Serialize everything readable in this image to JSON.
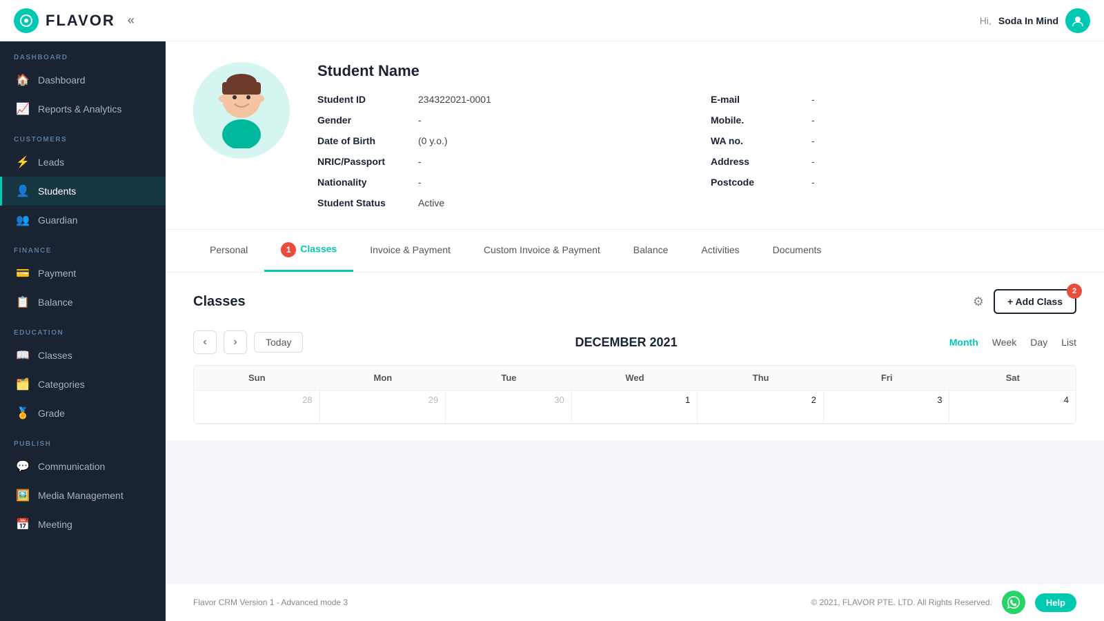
{
  "topnav": {
    "logo_text": "FLAVOR",
    "collapse_icon": "«",
    "greeting": "Hi,",
    "user_name": "Soda In Mind"
  },
  "sidebar": {
    "sections": [
      {
        "label": "DASHBOARD",
        "items": [
          {
            "id": "dashboard",
            "icon": "🏠",
            "label": "Dashboard",
            "active": false
          },
          {
            "id": "reports",
            "icon": "📈",
            "label": "Reports & Analytics",
            "active": false
          }
        ]
      },
      {
        "label": "CUSTOMERS",
        "items": [
          {
            "id": "leads",
            "icon": "⚡",
            "label": "Leads",
            "active": false
          },
          {
            "id": "students",
            "icon": "👤",
            "label": "Students",
            "active": true
          },
          {
            "id": "guardian",
            "icon": "👥",
            "label": "Guardian",
            "active": false
          }
        ]
      },
      {
        "label": "FINANCE",
        "items": [
          {
            "id": "payment",
            "icon": "💳",
            "label": "Payment",
            "active": false
          },
          {
            "id": "balance",
            "icon": "📋",
            "label": "Balance",
            "active": false
          }
        ]
      },
      {
        "label": "EDUCATION",
        "items": [
          {
            "id": "classes",
            "icon": "📖",
            "label": "Classes",
            "active": false
          },
          {
            "id": "categories",
            "icon": "🗂️",
            "label": "Categories",
            "active": false
          },
          {
            "id": "grade",
            "icon": "🏅",
            "label": "Grade",
            "active": false
          }
        ]
      },
      {
        "label": "PUBLISH",
        "items": [
          {
            "id": "communication",
            "icon": "💬",
            "label": "Communication",
            "active": false
          },
          {
            "id": "media",
            "icon": "🖼️",
            "label": "Media Management",
            "active": false
          },
          {
            "id": "meeting",
            "icon": "📅",
            "label": "Meeting",
            "active": false
          }
        ]
      }
    ]
  },
  "student": {
    "name": "Student Name",
    "avatar_emoji": "🧒",
    "fields_left": [
      {
        "label": "Student ID",
        "value": "234322021-0001"
      },
      {
        "label": "Gender",
        "value": "-"
      },
      {
        "label": "Date of Birth",
        "value": "(0 y.o.)"
      },
      {
        "label": "NRIC/Passport",
        "value": "-"
      },
      {
        "label": "Nationality",
        "value": "-"
      },
      {
        "label": "Student Status",
        "value": "Active"
      }
    ],
    "fields_right": [
      {
        "label": "E-mail",
        "value": "-"
      },
      {
        "label": "Mobile.",
        "value": "-"
      },
      {
        "label": "WA no.",
        "value": "-"
      },
      {
        "label": "Address",
        "value": "-"
      },
      {
        "label": "Postcode",
        "value": "-"
      }
    ]
  },
  "tabs": {
    "items": [
      {
        "id": "personal",
        "label": "Personal",
        "active": false,
        "badge": null
      },
      {
        "id": "classes",
        "label": "Classes",
        "active": true,
        "badge": "1"
      },
      {
        "id": "invoice-payment",
        "label": "Invoice & Payment",
        "active": false,
        "badge": null
      },
      {
        "id": "custom-invoice",
        "label": "Custom Invoice & Payment",
        "active": false,
        "badge": null
      },
      {
        "id": "balance",
        "label": "Balance",
        "active": false,
        "badge": null
      },
      {
        "id": "activities",
        "label": "Activities",
        "active": false,
        "badge": null
      },
      {
        "id": "documents",
        "label": "Documents",
        "active": false,
        "badge": null
      }
    ]
  },
  "classes_section": {
    "title": "Classes",
    "add_button_label": "+ Add Class",
    "add_button_badge": "2"
  },
  "calendar": {
    "month_title": "DECEMBER 2021",
    "today_label": "Today",
    "view_buttons": [
      {
        "id": "month",
        "label": "Month",
        "active": true
      },
      {
        "id": "week",
        "label": "Week",
        "active": false
      },
      {
        "id": "day",
        "label": "Day",
        "active": false
      },
      {
        "id": "list",
        "label": "List",
        "active": false
      }
    ],
    "day_headers": [
      "Sun",
      "Mon",
      "Tue",
      "Wed",
      "Thu",
      "Fri",
      "Sat"
    ],
    "weeks": [
      [
        {
          "day": "28",
          "other": true
        },
        {
          "day": "29",
          "other": true
        },
        {
          "day": "30",
          "other": true
        },
        {
          "day": "1",
          "other": false
        },
        {
          "day": "2",
          "other": false
        },
        {
          "day": "3",
          "other": false
        },
        {
          "day": "4",
          "other": false
        }
      ]
    ]
  },
  "footer": {
    "version": "Flavor CRM Version 1 - Advanced mode 3",
    "copyright": "© 2021, FLAVOR PTE. LTD. All Rights Reserved.",
    "help_label": "Help"
  }
}
